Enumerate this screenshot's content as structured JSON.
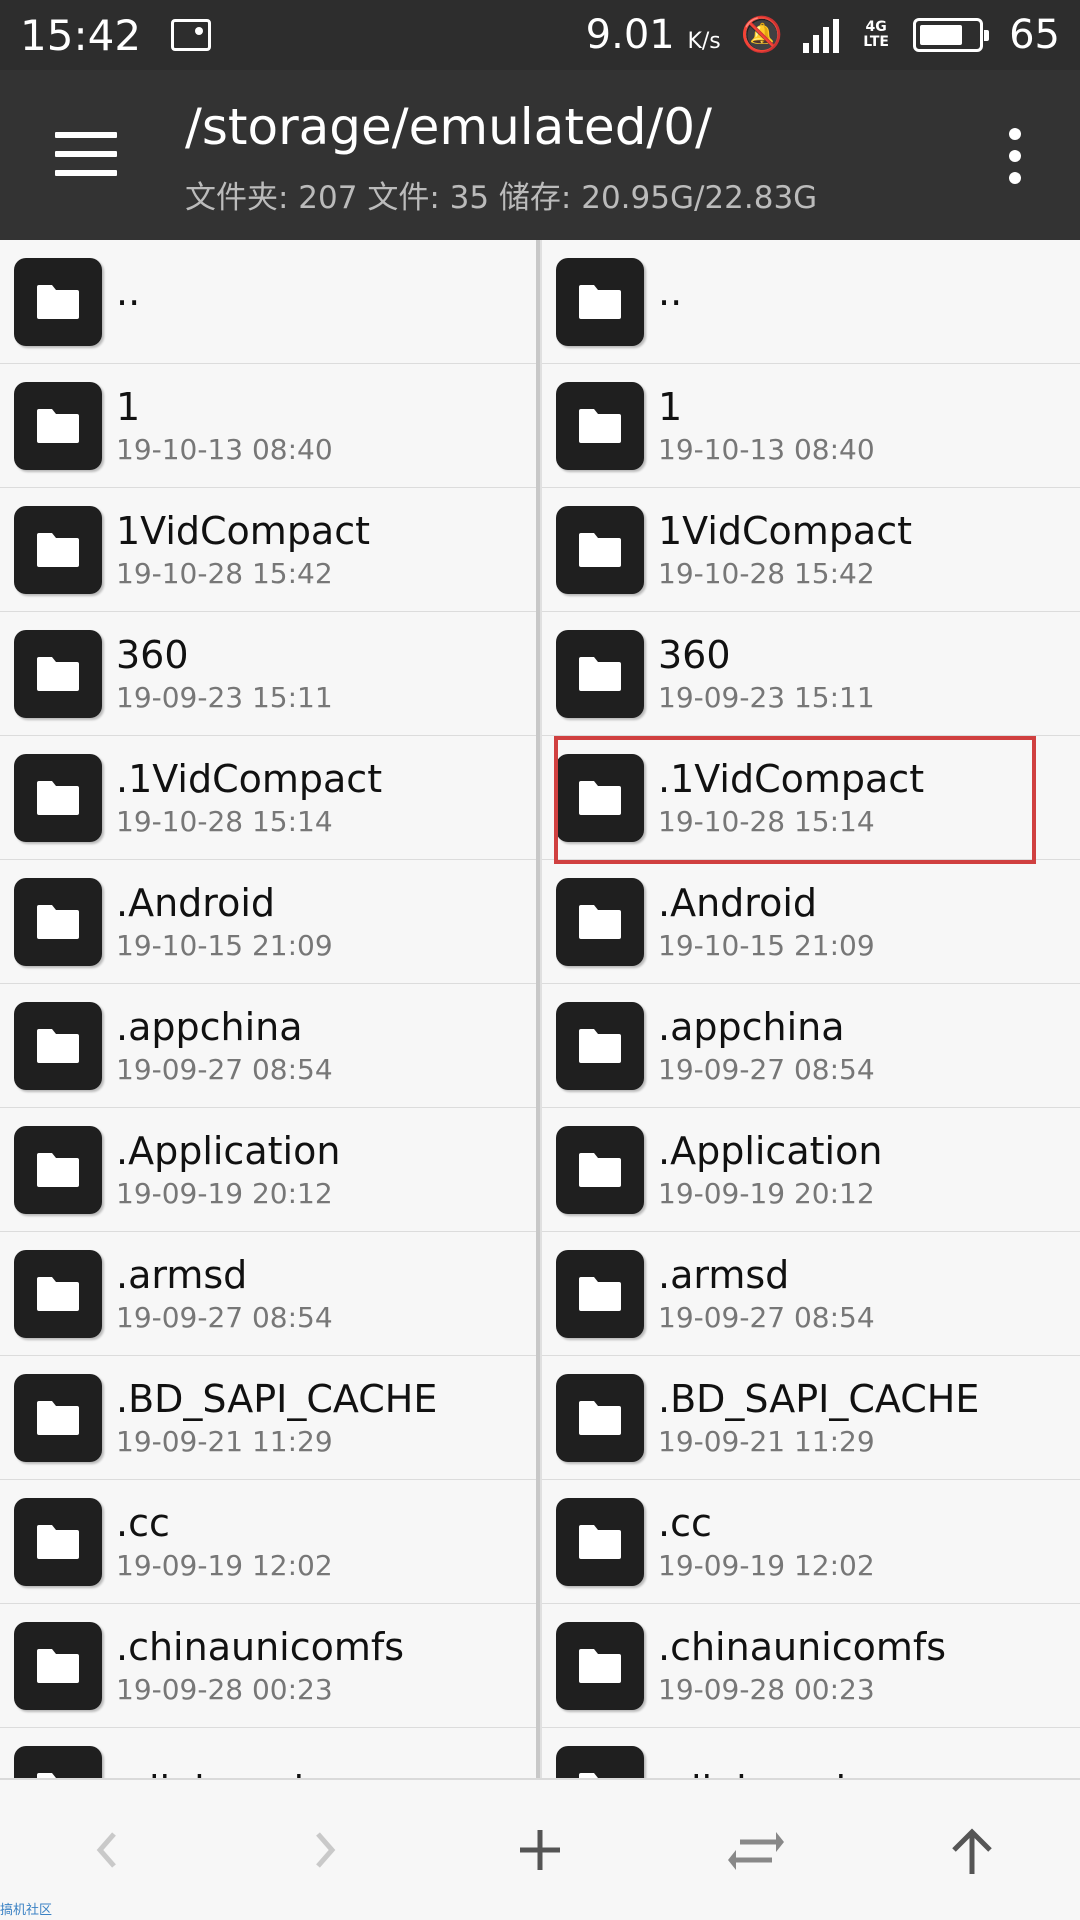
{
  "status_bar": {
    "time": "15:42",
    "speed_value": "9.01",
    "speed_unit": "K/s",
    "network": "4G LTE",
    "battery": "65"
  },
  "header": {
    "path": "/storage/emulated/0/",
    "stats": "文件夹: 207  文件: 35  储存: 20.95G/22.83G"
  },
  "left_pane": {
    "items": [
      {
        "name": "..",
        "date": ""
      },
      {
        "name": "1",
        "date": "19-10-13 08:40"
      },
      {
        "name": "1VidCompact",
        "date": "19-10-28 15:42"
      },
      {
        "name": "360",
        "date": "19-09-23 15:11"
      },
      {
        "name": ".1VidCompact",
        "date": "19-10-28 15:14"
      },
      {
        "name": ".Android",
        "date": "19-10-15 21:09"
      },
      {
        "name": ".appchina",
        "date": "19-09-27 08:54"
      },
      {
        "name": ".Application",
        "date": "19-09-19 20:12"
      },
      {
        "name": ".armsd",
        "date": "19-09-27 08:54"
      },
      {
        "name": ".BD_SAPI_CACHE",
        "date": "19-09-21 11:29"
      },
      {
        "name": ".cc",
        "date": "19-09-19 12:02"
      },
      {
        "name": ".chinaunicomfs",
        "date": "19-09-28 00:23"
      },
      {
        "name": ".clipboard",
        "date": ""
      }
    ]
  },
  "right_pane": {
    "items": [
      {
        "name": "..",
        "date": ""
      },
      {
        "name": "1",
        "date": "19-10-13 08:40"
      },
      {
        "name": "1VidCompact",
        "date": "19-10-28 15:42"
      },
      {
        "name": "360",
        "date": "19-09-23 15:11"
      },
      {
        "name": ".1VidCompact",
        "date": "19-10-28 15:14"
      },
      {
        "name": ".Android",
        "date": "19-10-15 21:09"
      },
      {
        "name": ".appchina",
        "date": "19-09-27 08:54"
      },
      {
        "name": ".Application",
        "date": "19-09-19 20:12"
      },
      {
        "name": ".armsd",
        "date": "19-09-27 08:54"
      },
      {
        "name": ".BD_SAPI_CACHE",
        "date": "19-09-21 11:29"
      },
      {
        "name": ".cc",
        "date": "19-09-19 12:02"
      },
      {
        "name": ".chinaunicomfs",
        "date": "19-09-28 00:23"
      },
      {
        "name": ".clipboard",
        "date": ""
      }
    ],
    "highlighted_index": 4
  },
  "toolbar": {
    "icons": [
      "back-icon",
      "forward-icon",
      "add-icon",
      "swap-icon",
      "up-icon"
    ]
  },
  "colors": {
    "appbar": "#333333",
    "statusbar": "#2d2d2d",
    "highlight": "#d04040",
    "folder_tile": "#1f1f1f"
  },
  "watermark": "搞机社区"
}
